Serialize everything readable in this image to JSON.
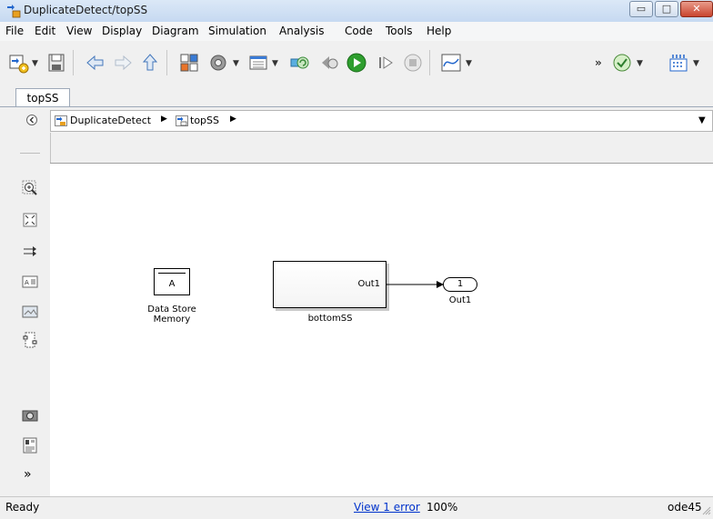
{
  "window": {
    "title": "DuplicateDetect/topSS",
    "minimize_glyph": "▭",
    "maximize_glyph": "□",
    "close_glyph": "✕"
  },
  "menu": [
    "File",
    "Edit",
    "View",
    "Display",
    "Diagram",
    "Simulation",
    "Analysis",
    "Code",
    "Tools",
    "Help"
  ],
  "toolbar": {
    "overflow_glyph": "»",
    "icons": [
      "new-model-icon",
      "save-icon",
      "back-icon",
      "forward-icon",
      "up-icon",
      "library-browser-icon",
      "settings-gear-icon",
      "model-explorer-icon",
      "update-diagram-icon",
      "step-back-icon",
      "run-icon",
      "step-forward-icon",
      "stop-icon",
      "scope-icon",
      "check-icon",
      "build-icon"
    ]
  },
  "tabs": [
    {
      "label": "topSS"
    }
  ],
  "breadcrumb": {
    "items": [
      "DuplicateDetect",
      "topSS"
    ],
    "dropdown_glyph": "▼"
  },
  "palette": {
    "icons": [
      "hide-browser-icon",
      "zoom-icon",
      "fit-view-icon",
      "route-lines-icon",
      "annotation-icon",
      "image-icon",
      "area-icon",
      "camera-icon",
      "report-icon",
      "expand-palette-icon"
    ],
    "expand_glyph": "»"
  },
  "diagram": {
    "data_store": {
      "symbol": "A",
      "label_line1": "Data Store",
      "label_line2": "Memory"
    },
    "subsystem": {
      "port_label": "Out1",
      "name": "bottomSS"
    },
    "outport": {
      "number": "1",
      "name": "Out1"
    }
  },
  "status": {
    "state": "Ready",
    "error_link": "View 1 error",
    "zoom": "100%",
    "solver": "ode45"
  },
  "colors": {
    "link": "#0033cc",
    "run_green": "#2e9e2e",
    "close_red": "#c9442e"
  }
}
